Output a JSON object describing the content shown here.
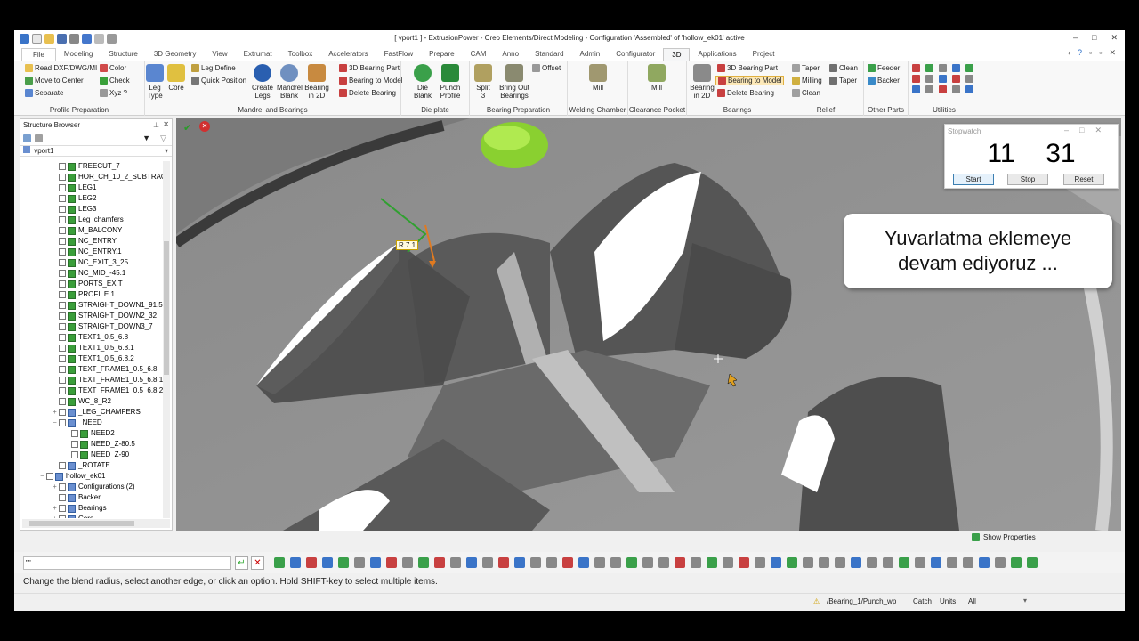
{
  "window": {
    "title": "[ vport1 ] - ExtrusionPower - Creo Elements/Direct Modeling - Configuration 'Assembled' of 'hollow_ek01' active",
    "controls": [
      "–",
      "□",
      "✕"
    ]
  },
  "tabs": [
    "File",
    "Modeling",
    "Structure",
    "3D Geometry",
    "View",
    "Extrumat",
    "Toolbox",
    "Accelerators",
    "FastFlow",
    "Prepare",
    "CAM",
    "Anno",
    "Standard",
    "Admin",
    "Configurator",
    "3D",
    "Applications",
    "Project"
  ],
  "ribbon": {
    "profile_preparation": {
      "label": "Profile Preparation",
      "items": [
        "Read DXF/DWG/MI",
        "Move to Center",
        "Separate",
        "Color",
        "Check",
        "Xyz ?"
      ]
    },
    "mandrel_and_bearings": {
      "label": "Mandrel and Bearings",
      "big": [
        "Leg Type",
        "Core",
        "Create Legs",
        "Mandrel Blank",
        "Bearing in 2D"
      ],
      "items": [
        "Leg Define",
        "Quick Position",
        "3D Bearing Part",
        "Bearing to Model",
        "Delete Bearing"
      ]
    },
    "die_plate": {
      "label": "Die plate",
      "big": [
        "Die Blank",
        "Punch Profile"
      ]
    },
    "bearing_preparation": {
      "label": "Bearing Preparation",
      "big": [
        "Split 3",
        "Bring Out Bearings"
      ],
      "items": [
        "Offset"
      ]
    },
    "welding_chamber": {
      "label": "Welding Chamber",
      "big": [
        "Mill"
      ]
    },
    "clearance_pocket": {
      "label": "Clearance Pocket",
      "big": [
        "Mill"
      ]
    },
    "bearings": {
      "label": "Bearings",
      "big": [
        "Bearing in 2D"
      ],
      "items": [
        "3D Bearing Part",
        "Bearing to Model",
        "Delete Bearing"
      ]
    },
    "relief": {
      "label": "Relief",
      "items": [
        "Taper",
        "Milling",
        "Clean",
        "Clean",
        "Taper"
      ]
    },
    "other_parts": {
      "label": "Other Parts",
      "items": [
        "Feeder",
        "Backer"
      ]
    },
    "utilities": {
      "label": "Utilities"
    }
  },
  "structure_browser": {
    "title": "Structure Browser",
    "root": "vport1",
    "rows": [
      {
        "label": "FREECUT_7",
        "indent": 1,
        "type": "part"
      },
      {
        "label": "HOR_CH_10_2_SUBTRAC",
        "indent": 1,
        "type": "part"
      },
      {
        "label": "LEG1",
        "indent": 1,
        "type": "part"
      },
      {
        "label": "LEG2",
        "indent": 1,
        "type": "part"
      },
      {
        "label": "LEG3",
        "indent": 1,
        "type": "part"
      },
      {
        "label": "Leg_chamfers",
        "indent": 1,
        "type": "part"
      },
      {
        "label": "M_BALCONY",
        "indent": 1,
        "type": "part"
      },
      {
        "label": "NC_ENTRY",
        "indent": 1,
        "type": "part"
      },
      {
        "label": "NC_ENTRY.1",
        "indent": 1,
        "type": "part"
      },
      {
        "label": "NC_EXIT_3_25",
        "indent": 1,
        "type": "part"
      },
      {
        "label": "NC_MID_-45.1",
        "indent": 1,
        "type": "part"
      },
      {
        "label": "PORTS_EXIT",
        "indent": 1,
        "type": "part"
      },
      {
        "label": "PROFILE.1",
        "indent": 1,
        "type": "part"
      },
      {
        "label": "STRAIGHT_DOWN1_91.5",
        "indent": 1,
        "type": "part"
      },
      {
        "label": "STRAIGHT_DOWN2_32",
        "indent": 1,
        "type": "part"
      },
      {
        "label": "STRAIGHT_DOWN3_7",
        "indent": 1,
        "type": "part"
      },
      {
        "label": "TEXT1_0.5_6.8",
        "indent": 1,
        "type": "part"
      },
      {
        "label": "TEXT1_0.5_6.8.1",
        "indent": 1,
        "type": "part"
      },
      {
        "label": "TEXT1_0.5_6.8.2",
        "indent": 1,
        "type": "part"
      },
      {
        "label": "TEXT_FRAME1_0.5_6.8",
        "indent": 1,
        "type": "part"
      },
      {
        "label": "TEXT_FRAME1_0.5_6.8.1",
        "indent": 1,
        "type": "part"
      },
      {
        "label": "TEXT_FRAME1_0.5_6.8.2",
        "indent": 1,
        "type": "part"
      },
      {
        "label": "WC_8_R2",
        "indent": 1,
        "type": "part"
      },
      {
        "label": "_LEG_CHAMFERS",
        "indent": 1,
        "type": "asm",
        "expander": "+"
      },
      {
        "label": "_NEED",
        "indent": 1,
        "type": "asm",
        "expander": "−"
      },
      {
        "label": "NEED2",
        "indent": 2,
        "type": "part"
      },
      {
        "label": "NEED_Z-80.5",
        "indent": 2,
        "type": "part"
      },
      {
        "label": "NEED_Z-90",
        "indent": 2,
        "type": "part"
      },
      {
        "label": "_ROTATE",
        "indent": 1,
        "type": "asm"
      },
      {
        "label": "hollow_ek01",
        "indent": 0,
        "type": "asm",
        "expander": "−"
      },
      {
        "label": "Configurations (2)",
        "indent": 1,
        "type": "asm",
        "expander": "+"
      },
      {
        "label": "Backer",
        "indent": 1,
        "type": "asm"
      },
      {
        "label": "Bearings",
        "indent": 1,
        "type": "asm",
        "expander": "+"
      },
      {
        "label": "Core",
        "indent": 1,
        "type": "asm",
        "expander": "+"
      }
    ]
  },
  "viewport": {
    "radius_label": "R 7.1"
  },
  "stopwatch": {
    "title": "Stopwatch",
    "minutes": "11",
    "seconds": "31",
    "start": "Start",
    "stop": "Stop",
    "reset": "Reset"
  },
  "caption": {
    "line1": "Yuvarlatma eklemeye",
    "line2": "devam ediyoruz ..."
  },
  "command_bar": {
    "input_value": "\"\"",
    "show_properties": "Show Properties"
  },
  "prompt": "Change the blend radius, select another edge, or click an option. Hold SHIFT-key to select multiple items.",
  "status": {
    "path": "/Bearing_1/Punch_wp",
    "catch": "Catch",
    "units": "Units",
    "all": "All"
  }
}
